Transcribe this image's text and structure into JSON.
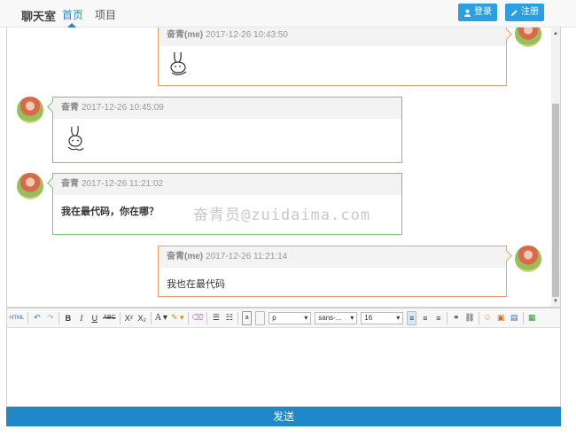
{
  "navbar": {
    "brand": "聊天室",
    "links": [
      {
        "label": "首页"
      },
      {
        "label": "项目"
      }
    ],
    "login_label": "登录",
    "register_label": "注册"
  },
  "messages": [
    {
      "side": "right",
      "name": "奋青(me)",
      "time": "2017-12-26 10:43:50",
      "text": "",
      "emoji": "rabbit-emoji"
    },
    {
      "side": "left",
      "name": "奋青",
      "time": "2017-12-26 10:45:09",
      "text": "",
      "emoji": "rabbit-emoji"
    },
    {
      "side": "left",
      "name": "奋青",
      "time": "2017-12-26 11:21:02",
      "text": "我在最代码，你在哪？",
      "bold": true
    },
    {
      "side": "right",
      "name": "奋青(me)",
      "time": "2017-12-26 11:21:14",
      "text": "我也在最代码"
    }
  ],
  "watermark": "奋青员@zuidaima.com",
  "toolbar": {
    "html_label": "HTML",
    "format_value": "p",
    "font_value": "sans-...",
    "size_value": "16"
  },
  "send_label": "发送",
  "colors": {
    "accent": "#1e88c9",
    "left_border": "#7cc47c",
    "right_border": "#f0a060"
  }
}
